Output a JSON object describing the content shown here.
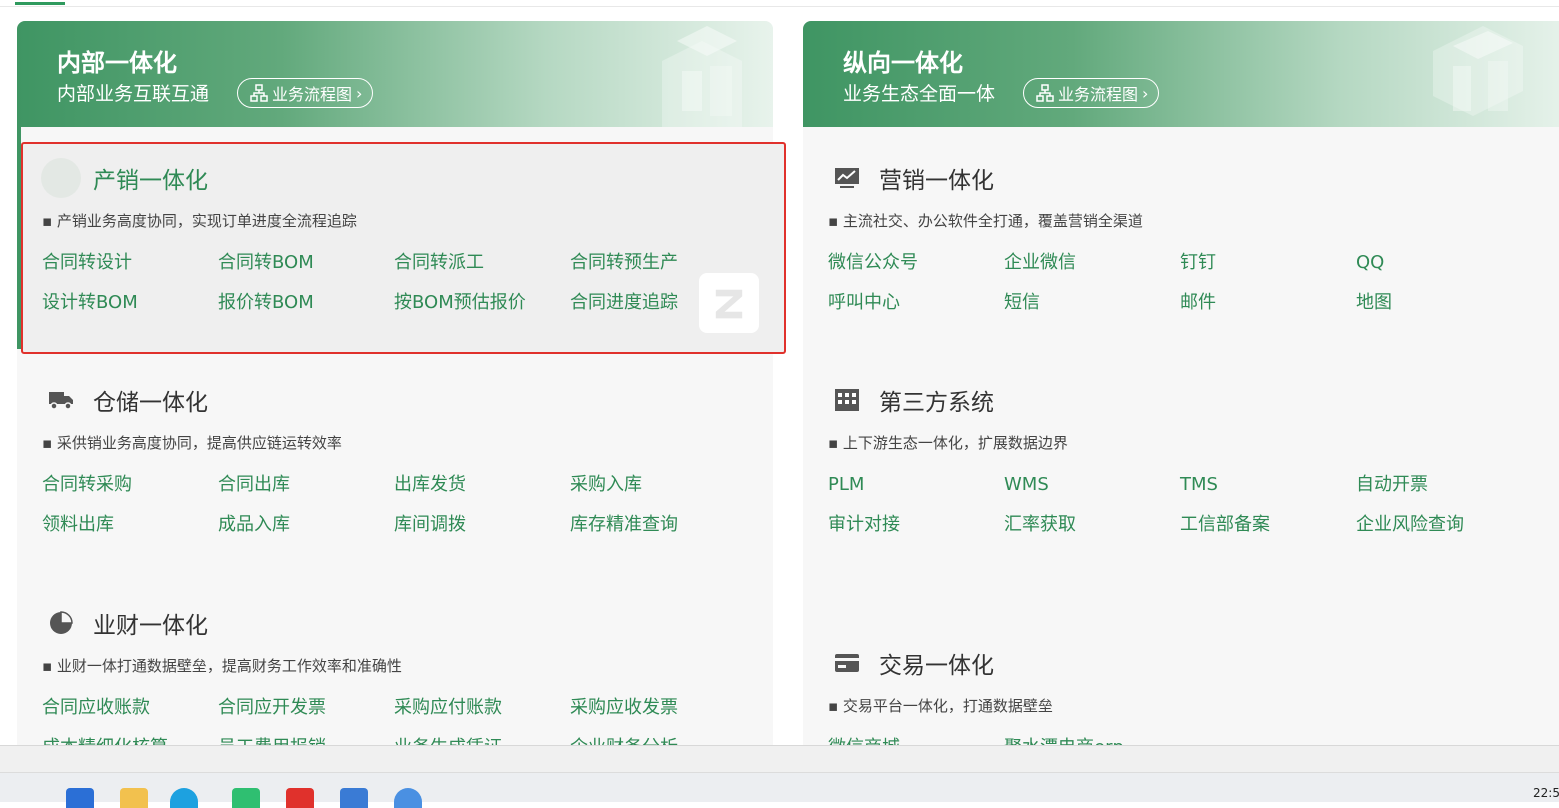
{
  "left_card": {
    "title": "内部一体化",
    "subtitle": "内部业务互联互通",
    "flow_button": "业务流程图",
    "sections": [
      {
        "title": "产销一体化",
        "desc": "▪ 产销业务高度协同，实现订单进度全流程追踪",
        "icon": "circle-icon",
        "links": [
          "合同转设计",
          "合同转BOM",
          "合同转派工",
          "合同转预生产",
          "设计转BOM",
          "报价转BOM",
          "按BOM预估报价",
          "合同进度追踪"
        ]
      },
      {
        "title": "仓储一体化",
        "desc": "▪ 采供销业务高度协同，提高供应链运转效率",
        "icon": "truck-icon",
        "links": [
          "合同转采购",
          "合同出库",
          "出库发货",
          "采购入库",
          "领料出库",
          "成品入库",
          "库间调拨",
          "库存精准查询"
        ]
      },
      {
        "title": "业财一体化",
        "desc": "▪ 业财一体打通数据壁垒，提高财务工作效率和准确性",
        "icon": "pie-chart-icon",
        "links": [
          "合同应收账款",
          "合同应开发票",
          "采购应付账款",
          "采购应收发票",
          "成本精细化核算",
          "员工费用报销",
          "业务生成凭证",
          "企业财务分析"
        ]
      }
    ]
  },
  "right_card": {
    "title": "纵向一体化",
    "subtitle": "业务生态全面一体",
    "flow_button": "业务流程图",
    "sections": [
      {
        "title": "营销一体化",
        "desc": "▪ 主流社交、办公软件全打通，覆盖营销全渠道",
        "icon": "monitor-chart-icon",
        "links": [
          "微信公众号",
          "企业微信",
          "钉钉",
          "QQ",
          "呼叫中心",
          "短信",
          "邮件",
          "地图"
        ]
      },
      {
        "title": "第三方系统",
        "desc": "▪ 上下游生态一体化，扩展数据边界",
        "icon": "building-icon",
        "links": [
          "PLM",
          "WMS",
          "TMS",
          "自动开票",
          "审计对接",
          "汇率获取",
          "工信部备案",
          "企业风险查询"
        ]
      },
      {
        "title": "交易一体化",
        "desc": "▪ 交易平台一体化，打通数据壁垒",
        "icon": "card-icon",
        "links": [
          "微信商城",
          "聚水潭电商erp"
        ]
      }
    ]
  },
  "taskbar": {
    "clock": "22:5"
  }
}
